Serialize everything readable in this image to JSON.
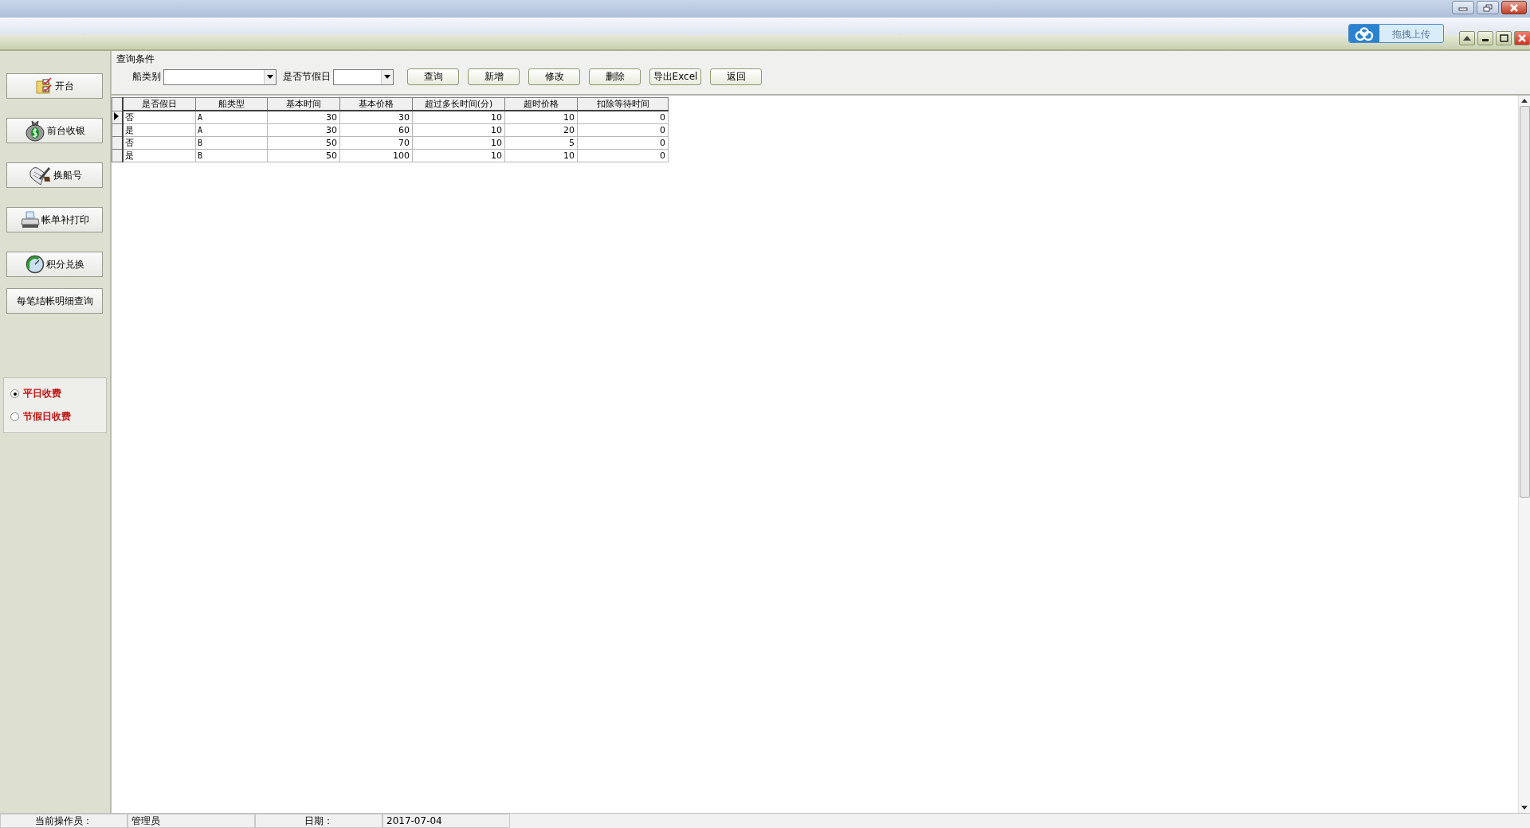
{
  "upload_button": {
    "label": "拖拽上传"
  },
  "sidebar": {
    "buttons": [
      {
        "label": "开台",
        "kind": "folder"
      },
      {
        "label": "前台收银",
        "kind": "moneybag"
      },
      {
        "label": "换船号",
        "kind": "scroll"
      },
      {
        "label": "帐单补打印",
        "kind": "printer"
      },
      {
        "label": "积分兑换",
        "kind": "exchange"
      },
      {
        "label": "每笔结帐明细查询",
        "kind": "text"
      }
    ],
    "fee_mode": [
      {
        "label": "平日收费",
        "selected": true
      },
      {
        "label": "节假日收费",
        "selected": false
      }
    ]
  },
  "query": {
    "title": "查询条件",
    "fields": [
      {
        "label": "船类别",
        "kind": "wide"
      },
      {
        "label": "是否节假日",
        "kind": "narrow"
      }
    ],
    "buttons": [
      "查询",
      "新增",
      "修改",
      "删除",
      "导出Excel",
      "返回"
    ]
  },
  "table": {
    "columns": [
      "是否假日",
      "船类型",
      "基本时间",
      "基本价格",
      "超过多长时间(分)",
      "超时价格",
      "扣除等待时间"
    ],
    "rows": [
      {
        "current": true,
        "cells": [
          "否",
          "A",
          "30",
          "30",
          "10",
          "10",
          "0"
        ]
      },
      {
        "current": false,
        "cells": [
          "是",
          "A",
          "30",
          "60",
          "10",
          "20",
          "0"
        ]
      },
      {
        "current": false,
        "cells": [
          "否",
          "B",
          "50",
          "70",
          "10",
          "5",
          "0"
        ]
      },
      {
        "current": false,
        "cells": [
          "是",
          "B",
          "50",
          "100",
          "10",
          "10",
          "0"
        ]
      }
    ]
  },
  "status_bar": [
    {
      "label": "当前操作员：",
      "value": "管理员"
    },
    {
      "label": "日期：",
      "value": "2017-07-04"
    }
  ]
}
